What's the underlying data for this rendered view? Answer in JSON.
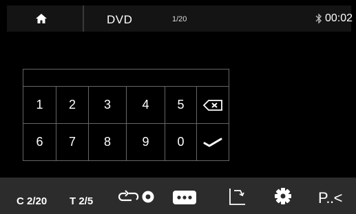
{
  "header": {
    "home_icon": "home-icon",
    "title": "DVD",
    "counter": "1/20",
    "bluetooth_icon": "bluetooth-icon",
    "time": "00:02"
  },
  "keypad": {
    "row1": [
      "1",
      "2",
      "3",
      "4",
      "5"
    ],
    "row2": [
      "6",
      "7",
      "8",
      "9",
      "0"
    ],
    "backspace_icon": "backspace-icon",
    "confirm_icon": "checkmark-icon"
  },
  "footer": {
    "chapter": "C 2/20",
    "title_track": "T 2/5",
    "repeat_icon": "repeat-icon",
    "more_icon": "more-icon",
    "angle_icon": "rotate-icon",
    "settings_icon": "gear-icon",
    "page_label": "P..<"
  }
}
